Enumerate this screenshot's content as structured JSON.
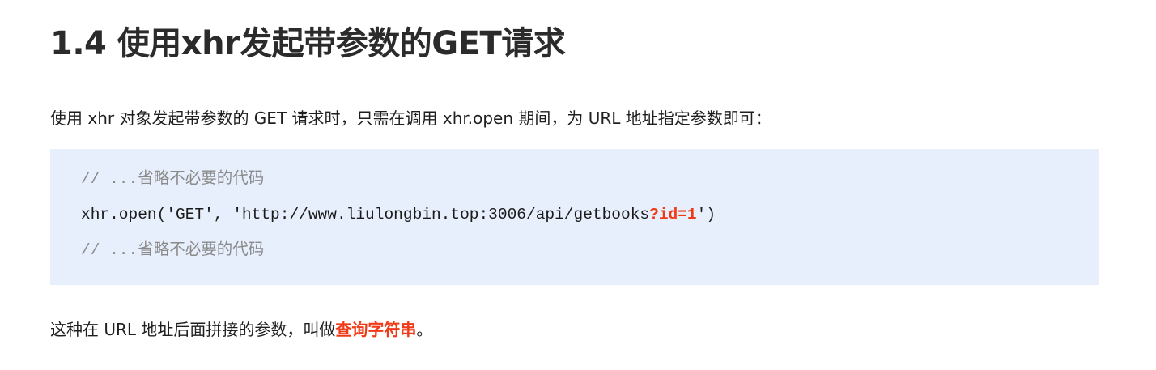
{
  "heading": "1.4 使用xhr发起带参数的GET请求",
  "intro": "使用 xhr 对象发起带参数的 GET 请求时，只需在调用 xhr.open 期间，为 URL 地址指定参数即可：",
  "code": {
    "comment_top": "// ...省略不必要的代码",
    "line_before": "xhr.open('GET', 'http://www.liulongbin.top:3006/api/getbooks",
    "line_highlight": "?id=1",
    "line_after": "')",
    "comment_bottom": "// ...省略不必要的代码"
  },
  "outro": {
    "text": "这种在 URL 地址后面拼接的参数，叫做",
    "highlight": "查询字符串",
    "end": "。"
  },
  "colors": {
    "highlight": "#f03a17",
    "code_background": "#e7effc",
    "comment": "#8a8a8a"
  }
}
